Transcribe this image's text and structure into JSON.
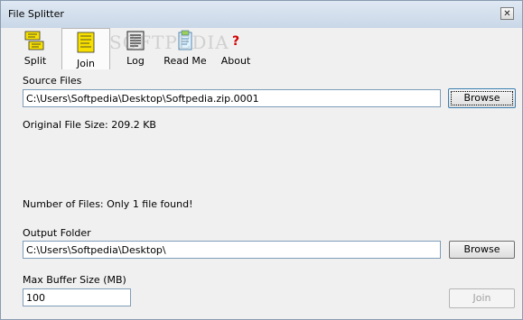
{
  "window": {
    "title": "File Splitter",
    "close_label": "✕"
  },
  "toolbar": {
    "items": [
      {
        "label": "Split",
        "icon": "split-icon"
      },
      {
        "label": "Join",
        "icon": "join-icon",
        "active": true
      },
      {
        "label": "Log",
        "icon": "log-icon"
      },
      {
        "label": "Read Me",
        "icon": "read-me-icon"
      },
      {
        "label": "About",
        "icon": "about-icon"
      }
    ]
  },
  "watermark": "SOFTPEDIA",
  "source": {
    "label": "Source Files",
    "value": "C:\\Users\\Softpedia\\Desktop\\Softpedia.zip.0001",
    "browse_label": "Browse"
  },
  "original_size": "Original File Size: 209.2 KB",
  "number_of_files": "Number of Files: Only 1 file found!",
  "output": {
    "label": "Output Folder",
    "value": "C:\\Users\\Softpedia\\Desktop\\",
    "browse_label": "Browse"
  },
  "buffer": {
    "label": "Max Buffer Size (MB)",
    "value": "100"
  },
  "join_button": "Join"
}
